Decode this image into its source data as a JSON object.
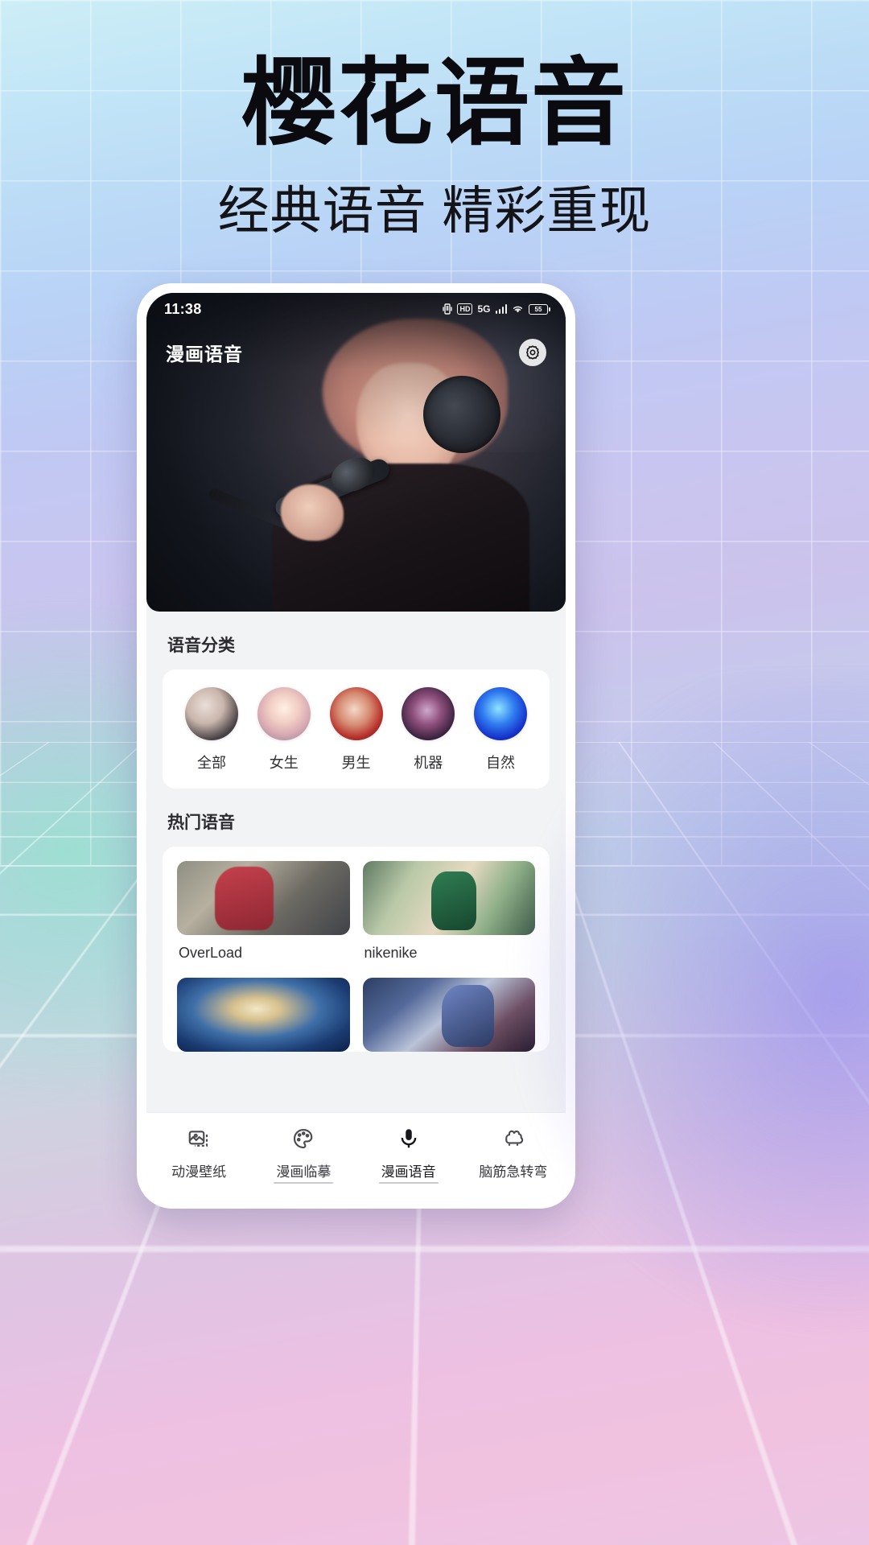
{
  "poster": {
    "title": "樱花语音",
    "subtitle": "经典语音  精彩重现",
    "background_colors": {
      "top_left": "#cdeef6",
      "mid": "#c6c9ec",
      "bottom_right": "#edc5e4",
      "grid_line": "#ffffff"
    }
  },
  "phone": {
    "status_bar": {
      "time": "11:38",
      "icons": [
        {
          "name": "vibrate-icon",
          "label": ""
        },
        {
          "name": "hd-icon",
          "label": "HD"
        },
        {
          "name": "network-5g-icon",
          "label": "5G"
        },
        {
          "name": "signal-bars-icon",
          "label": ""
        },
        {
          "name": "wifi-icon",
          "label": ""
        },
        {
          "name": "battery-icon",
          "label": "55"
        }
      ],
      "battery_level": "55"
    },
    "app_header": {
      "title": "漫画语音",
      "settings_icon": "gear-icon"
    },
    "hero": {
      "alt": "anime singer with headphones and microphone"
    },
    "sections": [
      {
        "id": "voice-categories",
        "title": "语音分类",
        "items": [
          {
            "label": "全部",
            "avatar": "avatar-all"
          },
          {
            "label": "女生",
            "avatar": "avatar-female"
          },
          {
            "label": "男生",
            "avatar": "avatar-male"
          },
          {
            "label": "机器",
            "avatar": "avatar-robot"
          },
          {
            "label": "自然",
            "avatar": "avatar-nature"
          }
        ]
      },
      {
        "id": "hot-voices",
        "title": "热门语音",
        "items": [
          {
            "name": "OverLoad",
            "thumb": "thumb-overload"
          },
          {
            "name": "nikenike",
            "thumb": "thumb-nikenike"
          },
          {
            "name": "",
            "thumb": "thumb-onepiece"
          },
          {
            "name": "",
            "thumb": "thumb-conan"
          }
        ]
      }
    ],
    "tabbar": {
      "active_index": 2,
      "tabs": [
        {
          "label": "动漫壁纸",
          "icon": "wallpaper-icon"
        },
        {
          "label": "漫画临摹",
          "icon": "palette-icon"
        },
        {
          "label": "漫画语音",
          "icon": "microphone-icon"
        },
        {
          "label": "脑筋急转弯",
          "icon": "brain-icon"
        }
      ]
    }
  }
}
